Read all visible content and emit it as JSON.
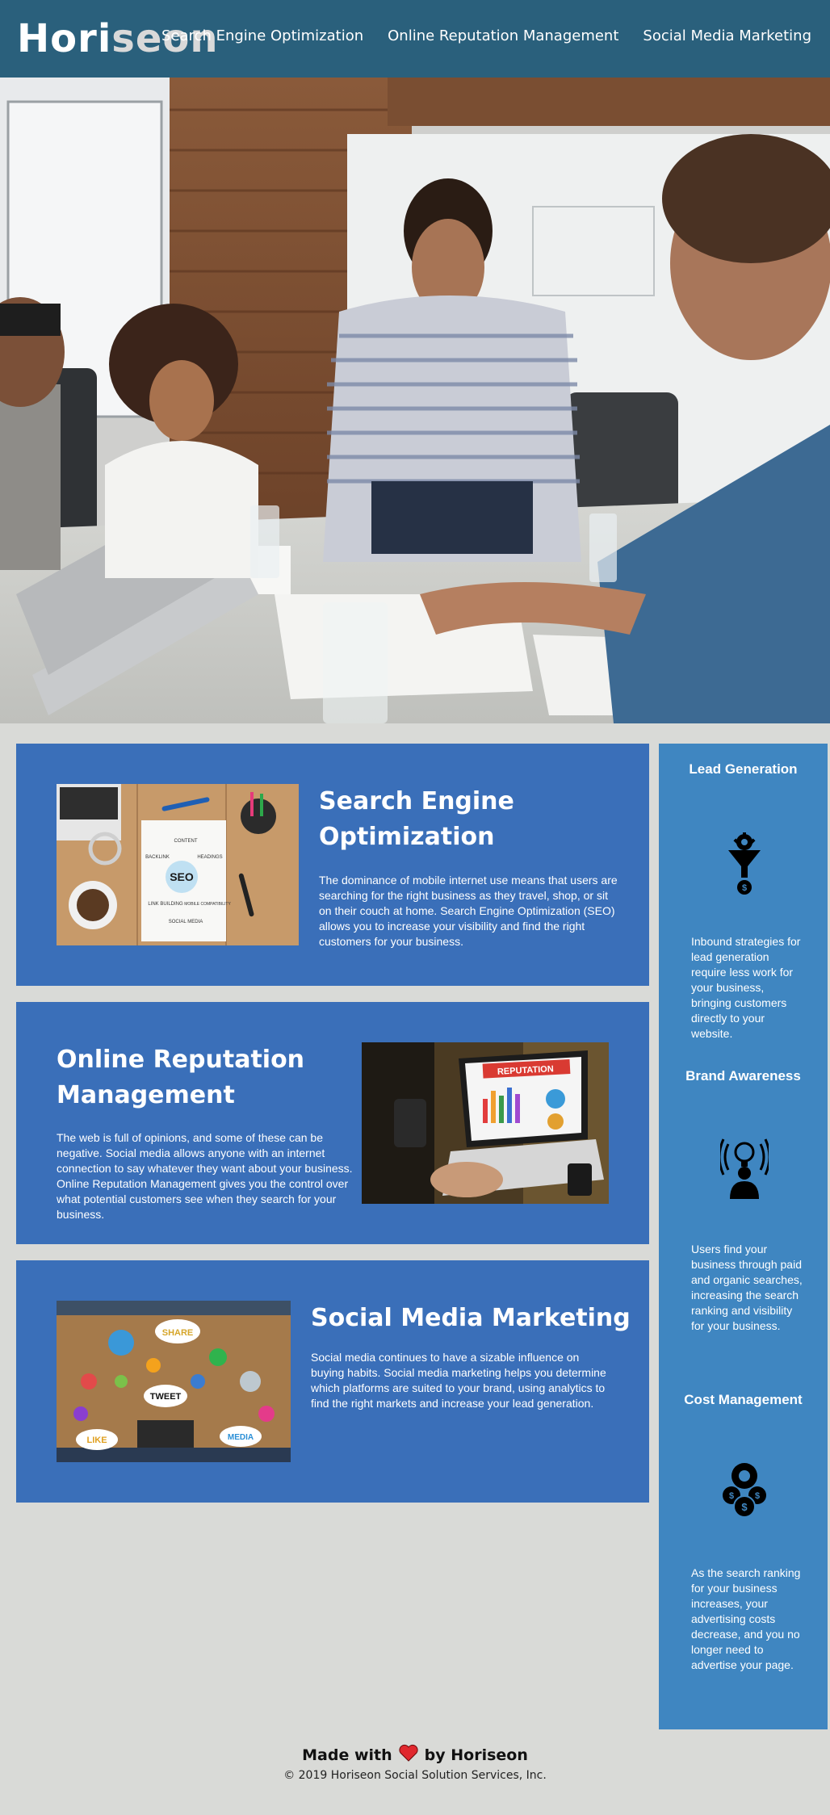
{
  "header": {
    "logo_main": "Hori",
    "logo_accent": "seon",
    "nav": [
      {
        "label": "Search Engine Optimization"
      },
      {
        "label": "Online Reputation Management"
      },
      {
        "label": "Social Media Marketing"
      }
    ]
  },
  "content": [
    {
      "title": "Search Engine Optimization",
      "text": "The dominance of mobile internet use means that users are searching for the right business as they travel, shop, or sit on their couch at home. Search Engine Optimization (SEO) allows you to increase your visibility and find the right customers for your business.",
      "image_label": "SEO",
      "image_words": [
        "CONTENT",
        "BACKLINK",
        "HEADINGS",
        "LINK BUILDING",
        "MOBILE COMPATIBILITY",
        "SOCIAL MEDIA"
      ]
    },
    {
      "title": "Online Reputation Management",
      "text": "The web is full of opinions, and some of these can be negative. Social media allows anyone with an internet connection to say whatever they want about your business. Online Reputation Management gives you the control over what potential customers see when they search for your business.",
      "image_label": "REPUTATION"
    },
    {
      "title": "Social Media Marketing",
      "text": "Social media continues to have a sizable influence on buying habits. Social media marketing helps you determine which platforms are suited to your brand, using analytics to find the right markets and increase your lead generation.",
      "image_words": [
        "SHARE",
        "TWEET",
        "LIKE",
        "MEDIA"
      ]
    }
  ],
  "benefits": [
    {
      "title": "Lead Generation",
      "icon": "lead-generation-icon",
      "text": "Inbound strategies for lead generation require less work for your business, bringing customers directly to your website."
    },
    {
      "title": "Brand Awareness",
      "icon": "brand-awareness-icon",
      "text": "Users find your business through paid and organic searches, increasing the search ranking and visibility for your business."
    },
    {
      "title": "Cost Management",
      "icon": "cost-management-icon",
      "text": "As the search ranking for your business increases, your advertising costs decrease, and you no longer need to advertise your page."
    }
  ],
  "footer": {
    "made_prefix": "Made with",
    "made_suffix": "by Horiseon",
    "copyright": "© 2019 Horiseon Social Solution Services, Inc."
  },
  "colors": {
    "header_bg": "#2a607c",
    "card_bg": "#3a6fb9",
    "sidebar_bg": "#3f86c1",
    "page_bg": "#d9dad7",
    "heart": "#e0282e"
  }
}
